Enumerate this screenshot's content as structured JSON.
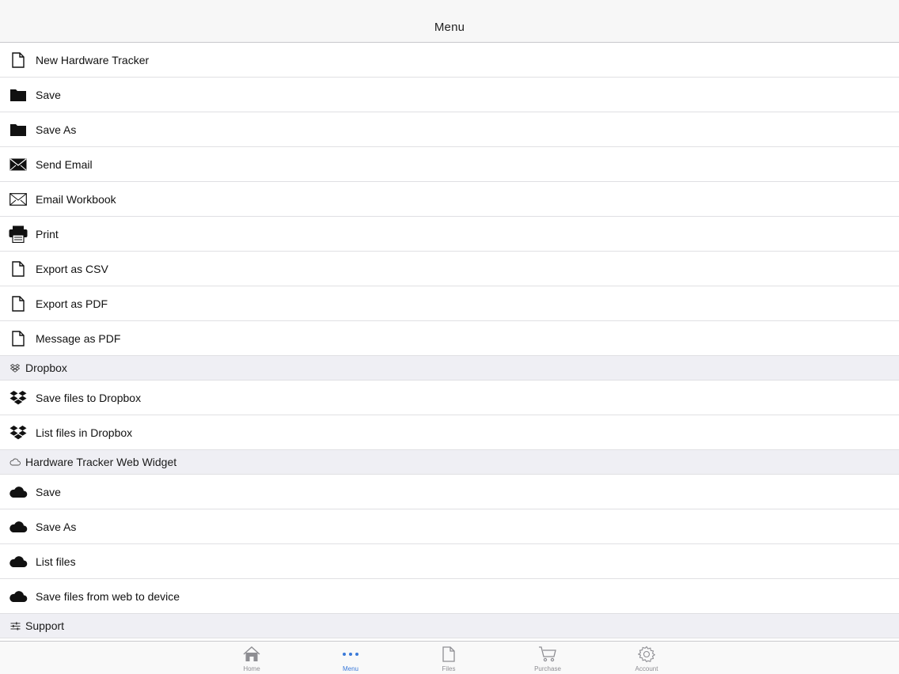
{
  "navbar": {
    "title": "Menu"
  },
  "menu": {
    "file_items": [
      {
        "label": "New Hardware Tracker",
        "icon": "document-icon"
      },
      {
        "label": "Save",
        "icon": "folder-icon"
      },
      {
        "label": "Save As",
        "icon": "folder-icon"
      },
      {
        "label": "Send Email",
        "icon": "envelope-filled-icon"
      },
      {
        "label": "Email Workbook",
        "icon": "envelope-outline-icon"
      },
      {
        "label": "Print",
        "icon": "printer-icon"
      },
      {
        "label": "Export as CSV",
        "icon": "document-icon"
      },
      {
        "label": "Export as PDF",
        "icon": "document-icon"
      },
      {
        "label": "Message as PDF",
        "icon": "document-icon"
      }
    ],
    "dropbox_section": {
      "title": "Dropbox",
      "icon": "dropbox-outline-icon",
      "items": [
        {
          "label": "Save files to Dropbox",
          "icon": "dropbox-icon"
        },
        {
          "label": "List files in Dropbox",
          "icon": "dropbox-icon"
        }
      ]
    },
    "web_section": {
      "title": "Hardware Tracker Web Widget",
      "icon": "cloud-outline-icon",
      "items": [
        {
          "label": "Save",
          "icon": "cloud-icon"
        },
        {
          "label": "Save As",
          "icon": "cloud-icon"
        },
        {
          "label": "List files",
          "icon": "cloud-icon"
        },
        {
          "label": "Save files from web to device",
          "icon": "cloud-icon"
        }
      ]
    },
    "support_section": {
      "title": "Support",
      "icon": "sliders-icon"
    }
  },
  "tabbar": {
    "tabs": [
      {
        "label": "Home",
        "icon": "home-icon",
        "active": false
      },
      {
        "label": "Menu",
        "icon": "more-dots-icon",
        "active": true
      },
      {
        "label": "Files",
        "icon": "file-icon",
        "active": false
      },
      {
        "label": "Purchase",
        "icon": "cart-icon",
        "active": false
      },
      {
        "label": "Account",
        "icon": "gear-icon",
        "active": false
      }
    ],
    "active_color": "#3b7ad9",
    "inactive_color": "#8e8e93"
  }
}
